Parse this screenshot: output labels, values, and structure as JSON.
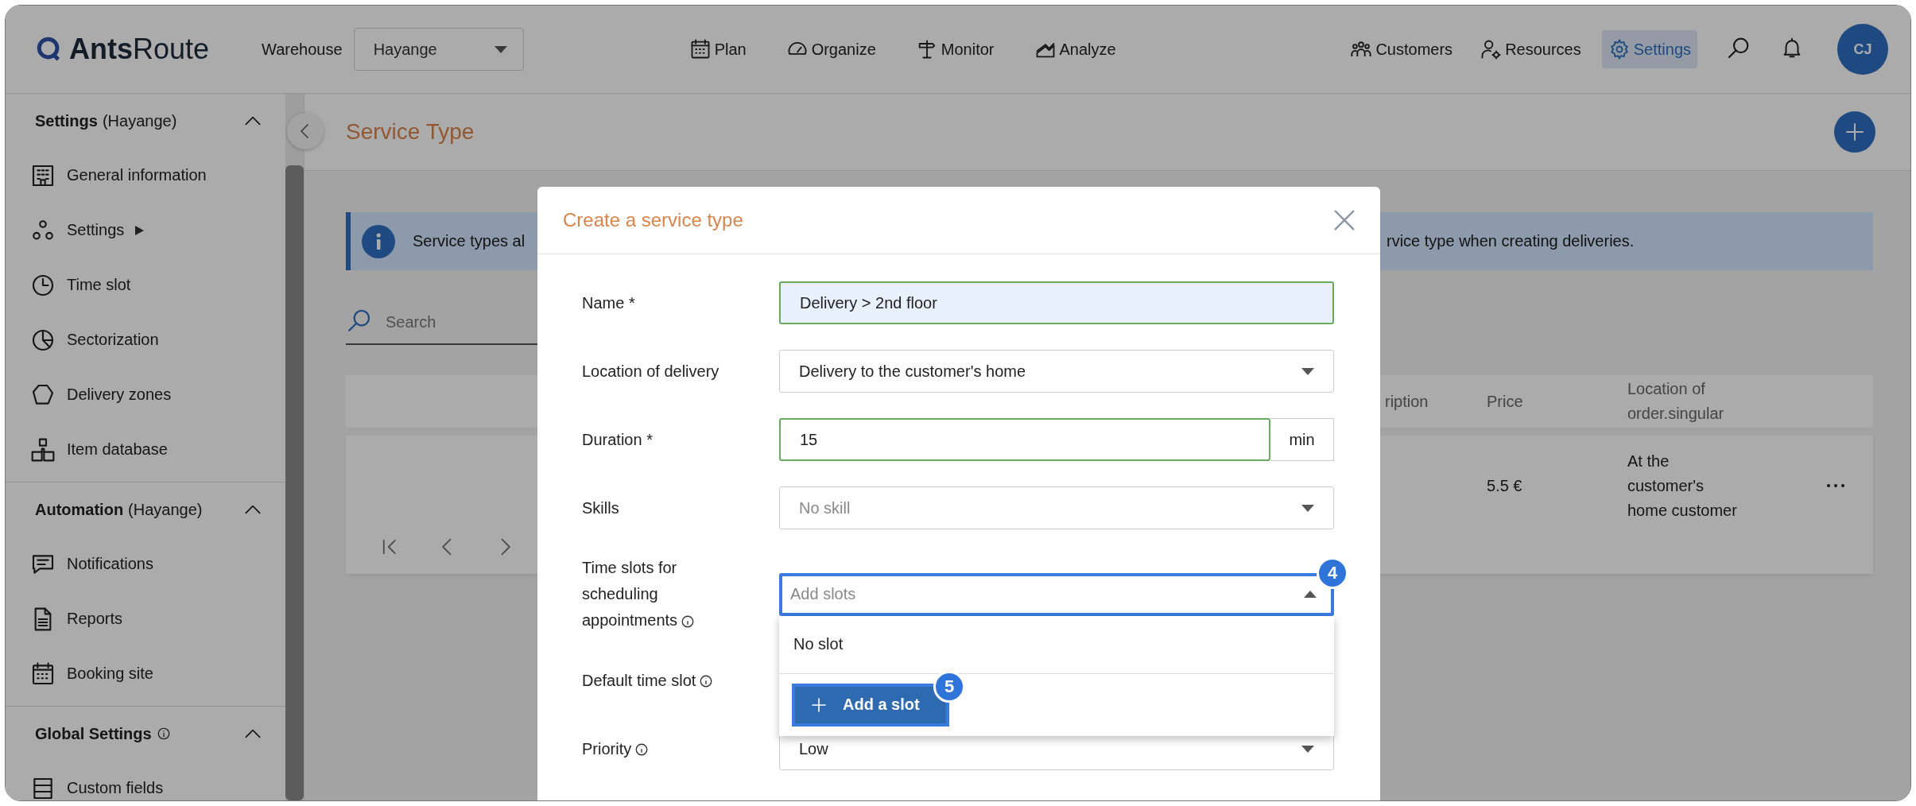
{
  "topbar": {
    "logo": "**Ants**Route",
    "warehouse": {
      "label": "Warehouse",
      "value": "Hayange"
    },
    "nav": [
      {
        "label": "Plan",
        "selected": false
      },
      {
        "label": "Organize",
        "selected": false
      },
      {
        "label": "Monitor",
        "selected": false
      },
      {
        "label": "Analyze",
        "selected": false
      }
    ],
    "nav_right": [
      {
        "label": "Customers",
        "selected": false
      },
      {
        "label": "Resources",
        "selected": false
      },
      {
        "label": "Settings",
        "selected": true
      }
    ],
    "avatar": "CJ"
  },
  "sidebar": {
    "sections": [
      {
        "title": "Settings",
        "context": "(Hayange)",
        "info": false,
        "expanded": true,
        "items": [
          {
            "label": "General information",
            "submenu": false
          },
          {
            "label": "Settings",
            "submenu": true
          },
          {
            "label": "Time slot",
            "submenu": false
          },
          {
            "label": "Sectorization",
            "submenu": false
          },
          {
            "label": "Delivery zones",
            "submenu": false
          },
          {
            "label": "Item database",
            "submenu": false
          }
        ]
      },
      {
        "title": "Automation",
        "context": "(Hayange)",
        "info": false,
        "expanded": true,
        "items": [
          {
            "label": "Notifications",
            "submenu": false
          },
          {
            "label": "Reports",
            "submenu": false
          },
          {
            "label": "Booking site",
            "submenu": false
          }
        ]
      },
      {
        "title": "Global Settings",
        "info": true,
        "expanded": true,
        "items": [
          {
            "label": "Custom fields",
            "submenu": false
          }
        ]
      }
    ]
  },
  "page": {
    "title": "Service Type",
    "banner": {
      "text_start": "Service types al",
      "text_end": "rvice type when creating deliveries."
    },
    "search": {
      "placeholder": "Search"
    },
    "table": {
      "columns": [
        "ription",
        "Price",
        "Location of order.singular"
      ],
      "rows": [
        {
          "price": "5.5 €",
          "location": "At the customer's home customer"
        }
      ]
    }
  },
  "modal": {
    "title": "Create a service type",
    "fields": [
      {
        "kind": "text",
        "label": "Name *",
        "value": "Delivery > 2nd floor",
        "valid": true
      },
      {
        "kind": "select",
        "label": "Location of delivery",
        "value": "Delivery to the customer's home",
        "valid": false
      },
      {
        "kind": "unit",
        "label": "Duration *",
        "value": "15",
        "unit": "min",
        "valid": true
      },
      {
        "kind": "select",
        "label": "Skills",
        "placeholder": "No skill",
        "valid": false
      },
      {
        "kind": "select",
        "label": "Time slots for scheduling appointments",
        "info": true,
        "placeholder": "Add slots",
        "valid": false,
        "focused": true,
        "expanded": true,
        "step": "4",
        "dropdown": {
          "options": [
            {
              "label": "No slot",
              "selected": false
            }
          ],
          "add_button": {
            "label": "Add a slot",
            "step": "5"
          }
        }
      },
      {
        "kind": "covered",
        "label": "Default time slot",
        "info": true
      },
      {
        "kind": "select",
        "label": "Priority",
        "info": true,
        "value": "Low",
        "valid": false
      }
    ]
  }
}
